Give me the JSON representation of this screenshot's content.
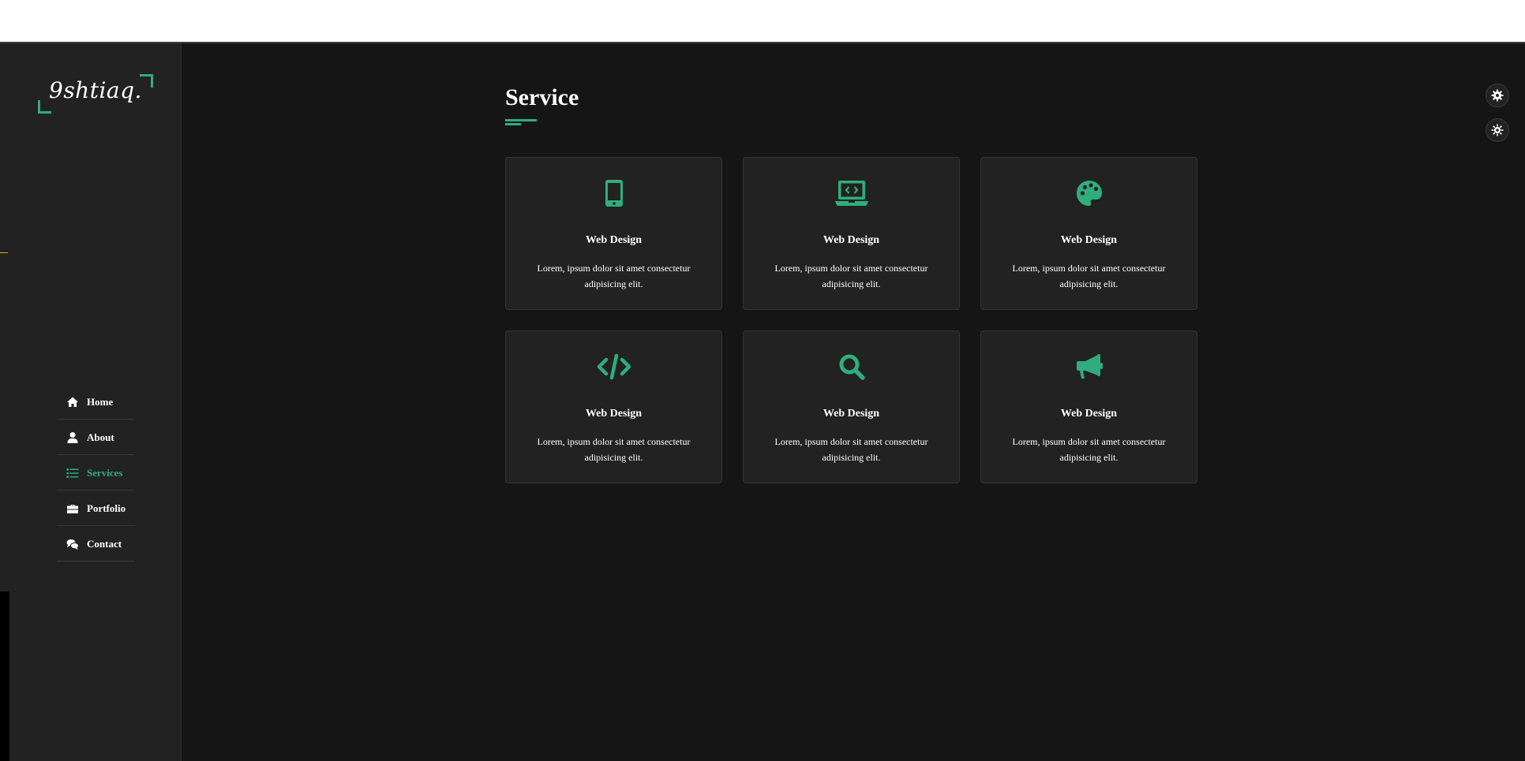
{
  "logo": {
    "text": "9shtiaq."
  },
  "nav": {
    "items": [
      {
        "label": "Home",
        "icon": "home-icon",
        "active": false
      },
      {
        "label": "About",
        "icon": "user-icon",
        "active": false
      },
      {
        "label": "Services",
        "icon": "list-icon",
        "active": true
      },
      {
        "label": "Portfolio",
        "icon": "briefcase-icon",
        "active": false
      },
      {
        "label": "Contact",
        "icon": "comments-icon",
        "active": false
      }
    ]
  },
  "section": {
    "title": "Service"
  },
  "services": [
    {
      "icon": "mobile-icon",
      "title": "Web Design",
      "description": "Lorem, ipsum dolor sit amet consectetur adipisicing elit."
    },
    {
      "icon": "laptop-code-icon",
      "title": "Web Design",
      "description": "Lorem, ipsum dolor sit amet consectetur adipisicing elit."
    },
    {
      "icon": "palette-icon",
      "title": "Web Design",
      "description": "Lorem, ipsum dolor sit amet consectetur adipisicing elit."
    },
    {
      "icon": "code-icon",
      "title": "Web Design",
      "description": "Lorem, ipsum dolor sit amet consectetur adipisicing elit."
    },
    {
      "icon": "search-icon",
      "title": "Web Design",
      "description": "Lorem, ipsum dolor sit amet consectetur adipisicing elit."
    },
    {
      "icon": "bullhorn-icon",
      "title": "Web Design",
      "description": "Lorem, ipsum dolor sit amet consectetur adipisicing elit."
    }
  ],
  "floating_buttons": [
    {
      "icon": "gear-icon"
    },
    {
      "icon": "sun-icon"
    }
  ],
  "colors": {
    "accent": "#2fad7e",
    "background": "#151515",
    "panel": "#222222"
  }
}
